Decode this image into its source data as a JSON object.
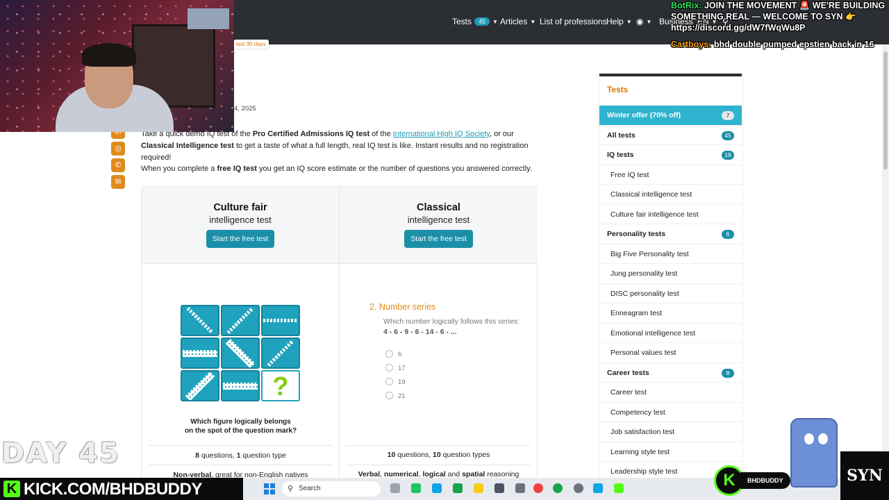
{
  "nav": {
    "tests_label": "Tests",
    "tests_count": "45",
    "articles_label": "Articles",
    "professions_label": "List of professions",
    "help_label": "Help",
    "business_label": "Business",
    "lang_label": "EN"
  },
  "stream": {
    "chat_line1_name": "BotRix:",
    "chat_line1_text": "JOIN THE MOVEMENT 🚨 WE'RE BUILDING SOMETHING REAL — WELCOME TO SYN 👉 https://discord.gg/dW7fWqWu8P",
    "chat_line2_name": "Cartboys:",
    "chat_line2_text": "bhd double pumped epstien back in 16",
    "day_label": "DAY 45",
    "kick_url": "KICK.COM/BHDBUDDY",
    "kick_username": "BHDBUDDY",
    "syn_logo": "SYN"
  },
  "article": {
    "badge_30_days": "last 30 days",
    "date_fragment": "4, 2025",
    "intro_p1_a": "Take a quick demo IQ test of the ",
    "intro_p1_b": "Pro Certified Admissions IQ test",
    "intro_p1_c": " of the ",
    "intro_p1_link": "International High IQ Society",
    "intro_p1_d": ", or our ",
    "intro_p1_e": "Classical Intelligence test",
    "intro_p1_f": " to get a taste of what a full length, real IQ test is like. Instant results and no registration required!",
    "intro_p2_a": "When you complete a ",
    "intro_p2_b": "free IQ test",
    "intro_p2_c": " you get an IQ score estimate or the number of questions you answered correctly."
  },
  "compare": {
    "left": {
      "title": "Culture fair",
      "subtitle": "intelligence test",
      "button": "Start the free test",
      "question_mark": "?",
      "caption_line1": "Which figure logically belongs",
      "caption_line2": "on the spot of the question mark?",
      "q_count": "8",
      "q_text1": " questions, ",
      "type_count": "1",
      "q_text2": " question type",
      "feature_bold": "Non-verbal",
      "feature_rest": ", great for non-English natives"
    },
    "right": {
      "title": "Classical",
      "subtitle": "intelligence test",
      "button": "Start the free test",
      "sample_title": "2. Number series",
      "sample_question": "Which number logically follows this series: ",
      "sample_series": "4 - 6 - 9 - 6 - 14 - 6 - ...",
      "options": [
        "6",
        "17",
        "19",
        "21"
      ],
      "q_count": "10",
      "q_text1": " questions, ",
      "type_count": "10",
      "q_text2": " question types",
      "feature_b1": "Verbal",
      "feature_s1": ", ",
      "feature_b2": "numerical",
      "feature_s2": ", ",
      "feature_b3": "logical",
      "feature_s3": " and ",
      "feature_b4": "spatial",
      "feature_s4": " reasoning"
    }
  },
  "sidebar": {
    "title": "Tests",
    "offer": {
      "label": "Winter offer (70% off)",
      "count": "7"
    },
    "items": [
      {
        "label": "All tests",
        "count": "45",
        "type": "cat"
      },
      {
        "label": "IQ tests",
        "count": "18",
        "type": "cat"
      },
      {
        "label": "Free IQ test",
        "type": "sub"
      },
      {
        "label": "Classical intelligence test",
        "type": "sub"
      },
      {
        "label": "Culture fair intelligence test",
        "type": "sub"
      },
      {
        "label": "Personality tests",
        "count": "6",
        "type": "cat"
      },
      {
        "label": "Big Five Personality test",
        "type": "sub"
      },
      {
        "label": "Jung personality test",
        "type": "sub"
      },
      {
        "label": "DISC personality test",
        "type": "sub"
      },
      {
        "label": "Enneagram test",
        "type": "sub"
      },
      {
        "label": "Emotional intelligence test",
        "type": "sub"
      },
      {
        "label": "Personal values test",
        "type": "sub"
      },
      {
        "label": "Career tests",
        "count": "8",
        "type": "cat"
      },
      {
        "label": "Career test",
        "type": "sub"
      },
      {
        "label": "Competency test",
        "type": "sub"
      },
      {
        "label": "Job satisfaction test",
        "type": "sub"
      },
      {
        "label": "Learning style test",
        "type": "sub"
      },
      {
        "label": "Leadership style test",
        "type": "sub"
      }
    ]
  },
  "taskbar": {
    "search_placeholder": "Search"
  },
  "colors": {
    "accent": "#1c8fa8",
    "nav_bg": "#2b2e33",
    "orange": "#e08a1e",
    "kick_green": "#53fc18"
  }
}
